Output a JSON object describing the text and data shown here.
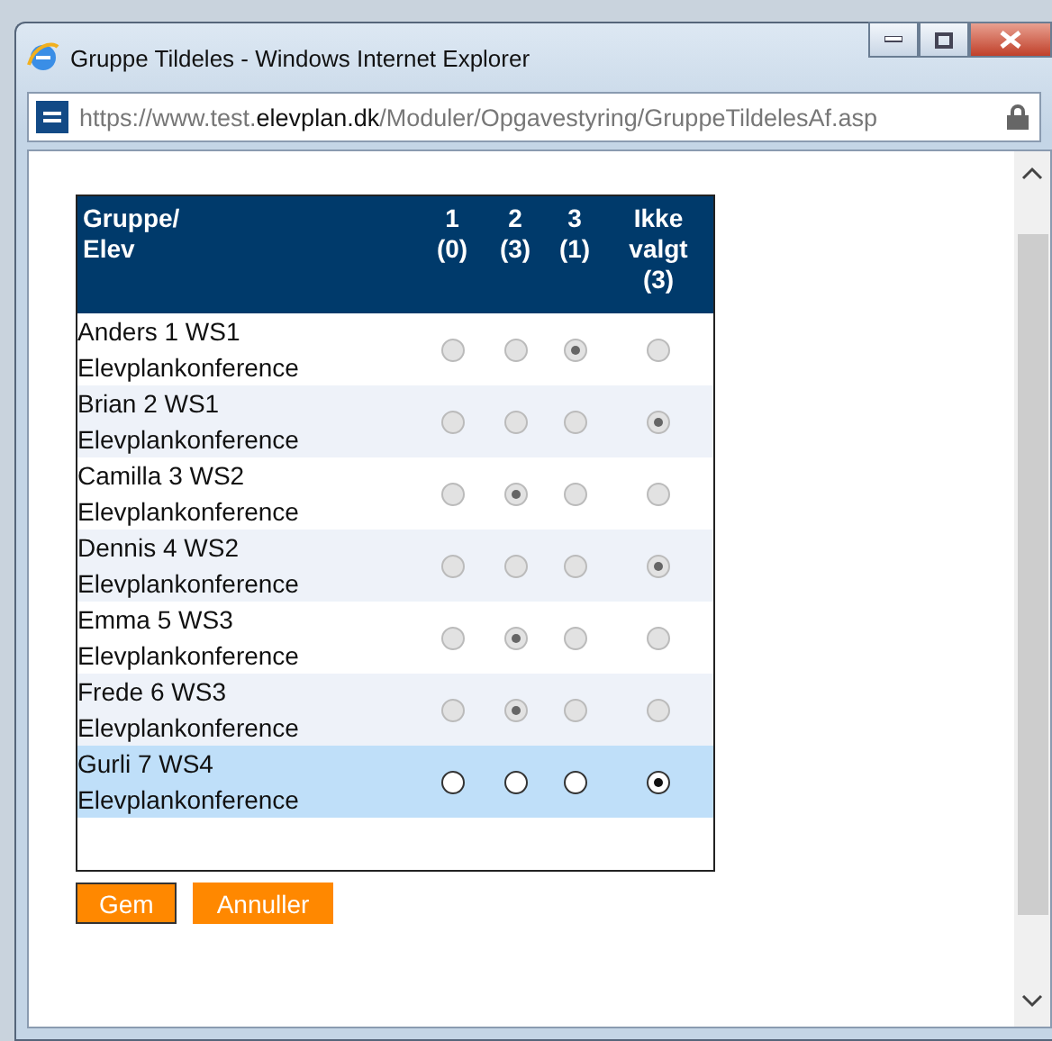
{
  "window": {
    "title": "Gruppe Tildeles - Windows Internet Explorer"
  },
  "address_bar": {
    "url": "https://www.test.**elevplan.dk**/Moduler/Opgavestyring/GruppeTildelesAf.asp"
  },
  "table": {
    "columns": [
      "Gruppe/\nElev",
      "1\n(0)",
      "2\n(3)",
      "3\n(1)",
      "Ikke\nvalgt\n(3)"
    ],
    "rows": [
      {
        "name": "Anders 1 WS1\nElevplankonference",
        "disabled": true,
        "highlighted": false,
        "options": [
          {
            "selected": false
          },
          {
            "selected": false
          },
          {
            "selected": true
          },
          {
            "selected": false
          }
        ]
      },
      {
        "name": "Brian 2 WS1\nElevplankonference",
        "disabled": true,
        "highlighted": false,
        "options": [
          {
            "selected": false
          },
          {
            "selected": false
          },
          {
            "selected": false
          },
          {
            "selected": true
          }
        ]
      },
      {
        "name": "Camilla 3 WS2\nElevplankonference",
        "disabled": true,
        "highlighted": false,
        "options": [
          {
            "selected": false
          },
          {
            "selected": true
          },
          {
            "selected": false
          },
          {
            "selected": false
          }
        ]
      },
      {
        "name": "Dennis 4 WS2\nElevplankonference",
        "disabled": true,
        "highlighted": false,
        "options": [
          {
            "selected": false
          },
          {
            "selected": false
          },
          {
            "selected": false
          },
          {
            "selected": true
          }
        ]
      },
      {
        "name": "Emma 5 WS3\nElevplankonference",
        "disabled": true,
        "highlighted": false,
        "options": [
          {
            "selected": false
          },
          {
            "selected": true
          },
          {
            "selected": false
          },
          {
            "selected": false
          }
        ]
      },
      {
        "name": "Frede 6 WS3\nElevplankonference",
        "disabled": true,
        "highlighted": false,
        "options": [
          {
            "selected": false
          },
          {
            "selected": true
          },
          {
            "selected": false
          },
          {
            "selected": false
          }
        ]
      },
      {
        "name": "Gurli 7 WS4\nElevplankonference",
        "disabled": false,
        "highlighted": true,
        "options": [
          {
            "selected": false
          },
          {
            "selected": false
          },
          {
            "selected": false
          },
          {
            "selected": true
          }
        ]
      }
    ]
  },
  "buttons": [
    {
      "label": "Gem",
      "focused": true
    },
    {
      "label": "Annuller",
      "focused": false
    }
  ]
}
